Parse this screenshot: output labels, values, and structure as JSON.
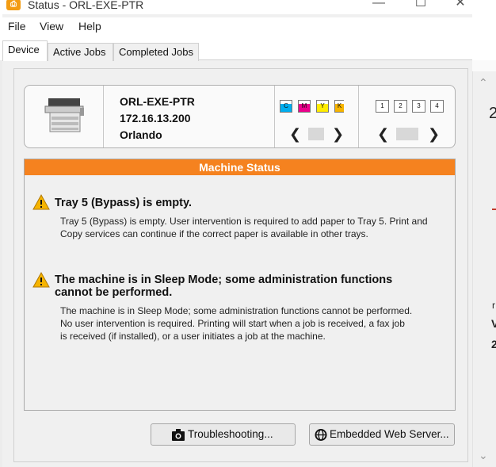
{
  "window": {
    "title": "Status - ORL-EXE-PTR"
  },
  "menu": [
    "File",
    "View",
    "Help"
  ],
  "tabs": [
    "Device",
    "Active Jobs",
    "Completed Jobs"
  ],
  "device": {
    "name": "ORL-EXE-PTR",
    "ip": "172.16.13.200",
    "location": "Orlando"
  },
  "toner_labels": [
    "C",
    "M",
    "Y",
    "K"
  ],
  "tray_labels": [
    "1",
    "2",
    "3",
    "4"
  ],
  "status": {
    "header": "Machine Status",
    "alerts": [
      {
        "title": "Tray 5 (Bypass) is empty.",
        "body": "Tray 5 (Bypass) is empty. User intervention is required to add paper to Tray 5. Print and Copy services can continue if the correct paper is available in other trays."
      },
      {
        "title": "The machine is in Sleep Mode; some administration functions cannot be performed.",
        "body": "The machine is in Sleep Mode; some administration functions cannot be performed. No user intervention is required. Printing will start when a job is received, a fax job is received (if installed), or a user initiates a job at the machine."
      }
    ]
  },
  "buttons": {
    "troubleshooting": "Troubleshooting...",
    "ews": "Embedded Web Server..."
  },
  "background_fragments": [
    "2",
    "r",
    "V",
    "2"
  ],
  "colors": {
    "status_header": "#f5821f",
    "alert_icon": "#f6b400"
  }
}
